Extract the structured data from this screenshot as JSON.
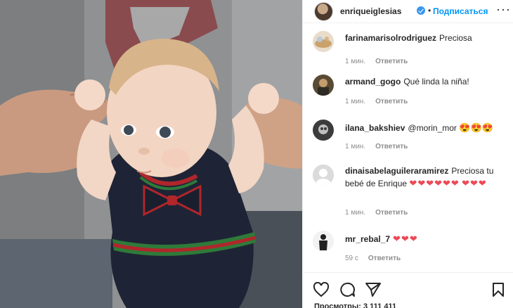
{
  "header": {
    "username": "enriqueiglesias",
    "dot": "•",
    "follow_label": "Подписаться",
    "more_label": "···"
  },
  "comments": [
    {
      "username": "farinamarisolrodriguez",
      "text": "Preciosa",
      "time": "1 мин.",
      "reply": "Ответить"
    },
    {
      "username": "armand_gogo",
      "text": "Qué linda la niña!",
      "time": "1 мин.",
      "reply": "Ответить"
    },
    {
      "username": "ilana_bakshiev",
      "text": "@morin_mor",
      "emoji": "😍😍😍",
      "time": "1 мин.",
      "reply": "Ответить"
    },
    {
      "username": "dinaisabelaguileraramirez",
      "text": "Preciosa tu bebé de Enrique",
      "hearts": "❤❤❤❤❤❤",
      "hearts2": "❤❤❤",
      "time": "1 мин.",
      "reply": "Ответить"
    },
    {
      "username": "mr_rebal_7",
      "text": "",
      "hearts": "❤❤❤",
      "time": "59 с",
      "reply": "Ответить"
    }
  ],
  "footer": {
    "views": "Просмотры: 3 111 411"
  },
  "colors": {
    "accent": "#0095f6",
    "verified": "#3897f0",
    "heart": "#ed4956",
    "meta": "#8e8e8e"
  },
  "icons": [
    "heart-outline-icon",
    "comment-icon",
    "share-icon",
    "bookmark-icon",
    "verified-badge-icon"
  ]
}
